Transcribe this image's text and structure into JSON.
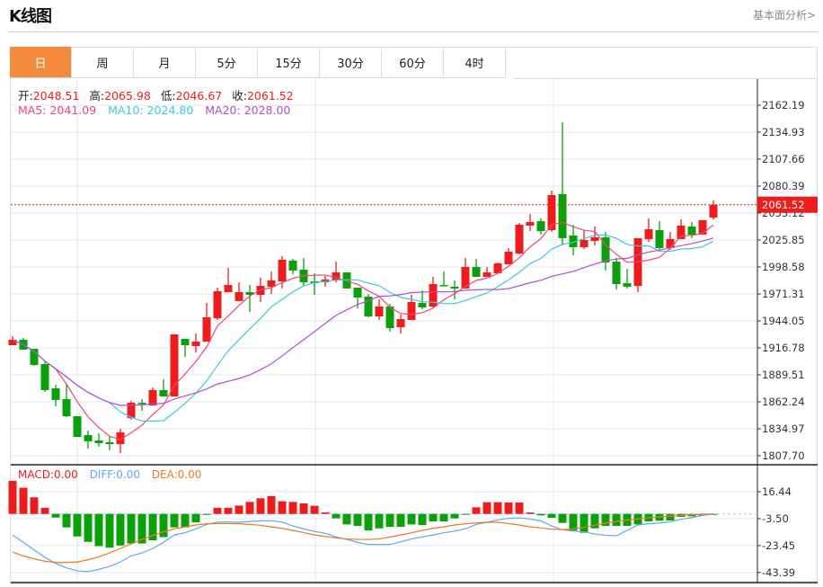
{
  "header": {
    "title": "K线图",
    "link": "基本面分析>"
  },
  "tabs": [
    {
      "label": "日",
      "active": true
    },
    {
      "label": "周"
    },
    {
      "label": "月"
    },
    {
      "label": "5分"
    },
    {
      "label": "15分"
    },
    {
      "label": "30分"
    },
    {
      "label": "60分"
    },
    {
      "label": "4时"
    }
  ],
  "ohlc_info": {
    "open_label": "开:",
    "open": "2048.51",
    "high_label": "高:",
    "high": "2065.98",
    "low_label": "低:",
    "low": "2046.67",
    "close_label": "收:",
    "close": "2061.52"
  },
  "ma_info": {
    "ma5": "MA5: 2041.09",
    "ma10": "MA10: 2024.80",
    "ma20": "MA20: 2028.00"
  },
  "macd_info": {
    "macd": "MACD:0.00",
    "diff": "DIFF:0.00",
    "dea": "DEA:0.00"
  },
  "colors": {
    "up": "#ee1c1c",
    "down": "#0aa00a",
    "ma5": "#f0457a",
    "ma10": "#3ec8dc",
    "ma20": "#b050c8",
    "diff": "#5aaaf0",
    "dea": "#f07820",
    "active_tab": "#f38b3e"
  },
  "chart_data": [
    {
      "type": "candlestick",
      "title": "",
      "last_price_label": "2061.52",
      "yticks": [
        "2162.19",
        "2134.93",
        "2107.66",
        "2080.39",
        "2053.12",
        "2025.85",
        "1998.58",
        "1971.31",
        "1944.05",
        "1916.78",
        "1889.51",
        "1862.24",
        "1834.97",
        "1807.70"
      ],
      "ylim": [
        1807.7,
        2162.19
      ],
      "ma_periods": [
        5,
        10,
        20
      ],
      "ohlc": [
        [
          1919.5,
          1928.6,
          1919.5,
          1925.0
        ],
        [
          1925.0,
          1926.8,
          1915.0,
          1915.0
        ],
        [
          1915.9,
          1915.9,
          1898.6,
          1899.5
        ],
        [
          1900.4,
          1904.1,
          1872.3,
          1874.1
        ],
        [
          1875.9,
          1879.5,
          1857.7,
          1864.1
        ],
        [
          1865.0,
          1880.4,
          1846.8,
          1847.7
        ],
        [
          1847.7,
          1847.7,
          1826.8,
          1826.8
        ],
        [
          1828.6,
          1833.2,
          1815.0,
          1822.3
        ],
        [
          1823.2,
          1830.4,
          1816.8,
          1820.4
        ],
        [
          1821.4,
          1827.7,
          1813.2,
          1819.5
        ],
        [
          1819.5,
          1835.0,
          1810.4,
          1831.4
        ],
        [
          1845.9,
          1863.2,
          1844.1,
          1861.3
        ],
        [
          1861.3,
          1865.0,
          1853.2,
          1860.4
        ],
        [
          1858.6,
          1876.8,
          1858.6,
          1874.1
        ],
        [
          1874.1,
          1885.0,
          1867.7,
          1867.7
        ],
        [
          1867.7,
          1930.4,
          1867.7,
          1930.4
        ],
        [
          1925.9,
          1925.9,
          1907.7,
          1919.5
        ],
        [
          1918.6,
          1931.3,
          1912.2,
          1923.1
        ],
        [
          1923.1,
          1962.2,
          1923.1,
          1947.7
        ],
        [
          1946.8,
          1977.7,
          1945.0,
          1974.1
        ],
        [
          1973.1,
          1997.7,
          1973.1,
          1980.4
        ],
        [
          1964.1,
          1983.1,
          1964.1,
          1973.1
        ],
        [
          1973.1,
          1980.4,
          1953.1,
          1970.4
        ],
        [
          1970.4,
          1987.7,
          1963.1,
          1979.5
        ],
        [
          1978.6,
          1994.0,
          1971.3,
          1985.0
        ],
        [
          1984.0,
          2009.5,
          1976.8,
          2005.9
        ],
        [
          2005.0,
          2006.8,
          1991.3,
          1995.0
        ],
        [
          1995.9,
          2007.7,
          1979.5,
          1983.1
        ],
        [
          1984.0,
          1992.2,
          1970.4,
          1982.2
        ],
        [
          1983.1,
          1989.5,
          1978.6,
          1985.9
        ],
        [
          1985.0,
          2004.0,
          1983.1,
          1993.1
        ],
        [
          1993.1,
          1993.1,
          1976.8,
          1976.8
        ],
        [
          1977.7,
          1977.7,
          1956.8,
          1967.7
        ],
        [
          1968.6,
          1971.3,
          1947.7,
          1948.6
        ],
        [
          1948.6,
          1965.9,
          1945.0,
          1958.6
        ],
        [
          1958.6,
          1961.3,
          1933.1,
          1936.8
        ],
        [
          1937.7,
          1950.4,
          1931.3,
          1945.9
        ],
        [
          1945.0,
          1970.4,
          1945.0,
          1963.1
        ],
        [
          1962.2,
          1975.0,
          1955.9,
          1957.7
        ],
        [
          1958.6,
          1988.6,
          1956.8,
          1981.3
        ],
        [
          1980.4,
          1994.0,
          1979.5,
          1979.5
        ],
        [
          1978.6,
          1985.0,
          1965.9,
          1976.8
        ],
        [
          1976.8,
          2007.7,
          1976.8,
          1998.6
        ],
        [
          1998.6,
          2006.8,
          1988.6,
          1988.6
        ],
        [
          1988.6,
          1998.6,
          1988.6,
          1993.1
        ],
        [
          1992.2,
          2003.1,
          1992.2,
          2002.2
        ],
        [
          2001.3,
          2017.7,
          2001.3,
          2014.0
        ],
        [
          2012.2,
          2043.1,
          2011.3,
          2041.3
        ],
        [
          2040.4,
          2052.2,
          2034.9,
          2044.0
        ],
        [
          2044.9,
          2047.7,
          2031.3,
          2034.9
        ],
        [
          2035.9,
          2075.8,
          2034.0,
          2071.3
        ],
        [
          2072.2,
          2144.9,
          2020.4,
          2027.7
        ],
        [
          2030.4,
          2041.3,
          2010.4,
          2018.6
        ],
        [
          2018.6,
          2035.9,
          2016.8,
          2025.9
        ],
        [
          2024.9,
          2039.5,
          2020.4,
          2028.6
        ],
        [
          2028.6,
          2034.0,
          1995.0,
          2003.1
        ],
        [
          2004.0,
          2007.7,
          1975.9,
          1981.3
        ],
        [
          1982.2,
          1996.8,
          1976.8,
          1978.6
        ],
        [
          1979.5,
          2027.7,
          1973.1,
          2027.7
        ],
        [
          2026.8,
          2047.7,
          2024.0,
          2036.8
        ],
        [
          2035.9,
          2044.9,
          2015.9,
          2017.7
        ],
        [
          2017.7,
          2034.0,
          2015.9,
          2026.8
        ],
        [
          2026.8,
          2046.8,
          2026.8,
          2040.4
        ],
        [
          2039.5,
          2044.0,
          2027.7,
          2031.3
        ],
        [
          2031.3,
          2045.9,
          2031.3,
          2045.9
        ],
        [
          2048.51,
          2065.98,
          2046.67,
          2061.52
        ]
      ]
    },
    {
      "type": "bar+line",
      "title": "",
      "yticks": [
        "16.44",
        "-3.50",
        "-23.45",
        "-43.39"
      ],
      "ylim": [
        -43.39,
        16.44
      ],
      "macd": [
        24.5,
        19.4,
        12.3,
        4.5,
        -2.7,
        -10.0,
        -16.7,
        -20.7,
        -23.9,
        -25.0,
        -23.4,
        -21.9,
        -21.9,
        -19.6,
        -17.2,
        -10.0,
        -10.0,
        -6.2,
        -0.7,
        4.5,
        4.5,
        6.2,
        8.9,
        11.6,
        13.2,
        9.4,
        8.9,
        7.8,
        6.0,
        1.1,
        -3.3,
        -7.8,
        -8.9,
        -12.3,
        -10.7,
        -9.6,
        -9.6,
        -7.8,
        -8.3,
        -5.6,
        -5.6,
        -3.3,
        -0.4,
        4.9,
        8.7,
        8.7,
        8.5,
        8.5,
        1.1,
        -1.1,
        -2.9,
        -6.7,
        -12.3,
        -14.0,
        -10.7,
        -8.9,
        -8.9,
        -8.9,
        -7.8,
        -5.6,
        -5.1,
        -4.9,
        -2.2,
        -1.8,
        -1.1,
        -0.2
      ],
      "diff": [
        -15.6,
        -21.1,
        -26.7,
        -32.2,
        -36.7,
        -40.0,
        -42.2,
        -42.7,
        -41.1,
        -38.9,
        -35.6,
        -31.1,
        -28.9,
        -25.6,
        -21.1,
        -15.6,
        -14.0,
        -11.1,
        -7.8,
        -6.0,
        -6.0,
        -6.2,
        -5.6,
        -5.1,
        -5.1,
        -6.0,
        -8.9,
        -11.1,
        -12.9,
        -14.4,
        -17.1,
        -18.9,
        -21.1,
        -22.7,
        -22.7,
        -22.7,
        -20.7,
        -18.5,
        -17.1,
        -15.6,
        -14.0,
        -12.7,
        -11.1,
        -7.8,
        -6.2,
        -4.4,
        -3.3,
        -2.9,
        -3.8,
        -5.1,
        -8.9,
        -11.8,
        -12.7,
        -13.3,
        -14.9,
        -15.8,
        -16.2,
        -12.2,
        -8.2,
        -7.3,
        -6.7,
        -6.0,
        -4.0,
        -2.7,
        -1.1,
        0.0
      ],
      "dea": [
        -28.2,
        -31.1,
        -33.3,
        -35.1,
        -36.0,
        -36.0,
        -35.6,
        -34.0,
        -31.8,
        -28.9,
        -25.6,
        -22.2,
        -18.9,
        -16.0,
        -13.3,
        -11.1,
        -9.6,
        -8.2,
        -7.3,
        -7.1,
        -7.1,
        -7.3,
        -7.8,
        -8.4,
        -9.6,
        -10.7,
        -12.2,
        -13.8,
        -15.6,
        -16.7,
        -17.8,
        -18.5,
        -18.9,
        -18.9,
        -18.5,
        -17.1,
        -15.6,
        -14.0,
        -12.2,
        -10.7,
        -9.6,
        -8.2,
        -7.3,
        -6.7,
        -6.2,
        -6.2,
        -7.1,
        -8.2,
        -9.6,
        -10.4,
        -11.3,
        -11.6,
        -11.1,
        -10.0,
        -8.4,
        -6.7,
        -5.6,
        -4.4,
        -3.8,
        -2.9,
        -2.2,
        -1.6,
        -1.1,
        -0.7,
        -0.2,
        0.0
      ]
    }
  ]
}
